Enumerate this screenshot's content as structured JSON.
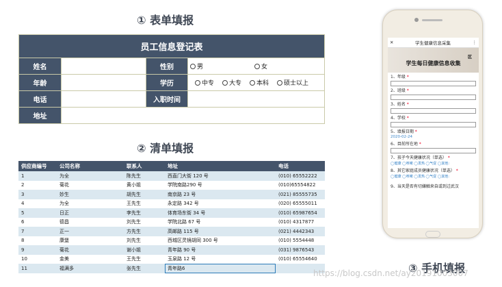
{
  "sections": {
    "s1": "① 表单填报",
    "s2": "② 清单填报",
    "s3": "③ 手机填报"
  },
  "form": {
    "title": "员工信息登记表",
    "name_label": "姓名",
    "gender_label": "性别",
    "gender_male": "男",
    "gender_female": "女",
    "age_label": "年龄",
    "edu_label": "学历",
    "edu_options": [
      "中专",
      "大专",
      "本科",
      "硕士以上"
    ],
    "phone_label": "电话",
    "join_label": "入职时间",
    "address_label": "地址"
  },
  "table": {
    "headers": [
      "供应商编号",
      "公司名称",
      "联系人",
      "地址",
      "电话"
    ],
    "rows": [
      [
        "1",
        "为全",
        "陈先生",
        "西直门大街 120 号",
        "(010) 65552222"
      ],
      [
        "2",
        "菊花",
        "黄小姐",
        "学院南路290 号",
        "(010)65554822"
      ],
      [
        "3",
        "妙生",
        "胡先生",
        "南京路 23 号",
        "(021) 85555735"
      ],
      [
        "4",
        "为全",
        "王先生",
        "永定路 342 号",
        "(020) 65555011"
      ],
      [
        "5",
        "日正",
        "李先生",
        "体育场东街 34 号",
        "(010) 65987654"
      ],
      [
        "6",
        "德昌",
        "刘先生",
        "学院北路 67 号",
        "(010) 4317877"
      ],
      [
        "7",
        "正一",
        "方先生",
        "高邮路 115 号",
        "(021) 4442343"
      ],
      [
        "8",
        "康堡",
        "刘先生",
        "西城区灵镜胡同 300 号",
        "(010) 5554448"
      ],
      [
        "9",
        "菊花",
        "谢小姐",
        "青年路 90 号",
        "(031) 9876543"
      ],
      [
        "10",
        "金美",
        "王先生",
        "玉泉路 12 号",
        "(010) 65554640"
      ],
      [
        "11",
        "福满多",
        "张先生",
        "青年路6",
        ""
      ]
    ]
  },
  "phone": {
    "topbar_title": "学生健康信息采集",
    "close": "✕",
    "menu": "⋮",
    "banner_top": "区",
    "banner_title": "学生每日健康信息收集",
    "q1": "1、年级",
    "q2": "2、班级",
    "q3": "3、姓名",
    "q4": "4、学校",
    "q5": "5、填报日期",
    "q5_value": "2020-02-24",
    "q6": "6、目前所在地",
    "q7": "7、孩子今天健康状况（单选）",
    "q7_opts": "◯健康 ◯咳嗽 ◯发热 ◯气促 ◯其他:",
    "q8": "8、其它家庭成员健康状况（单选）",
    "q8_opts": "◯健康 ◯咳嗽 ◯发热 ◯气促 ◯其他:",
    "q9": "9、当天是否有切嫌触来自或到过武汉"
  },
  "watermark": "https://blog.csdn.net/ay20191003007"
}
